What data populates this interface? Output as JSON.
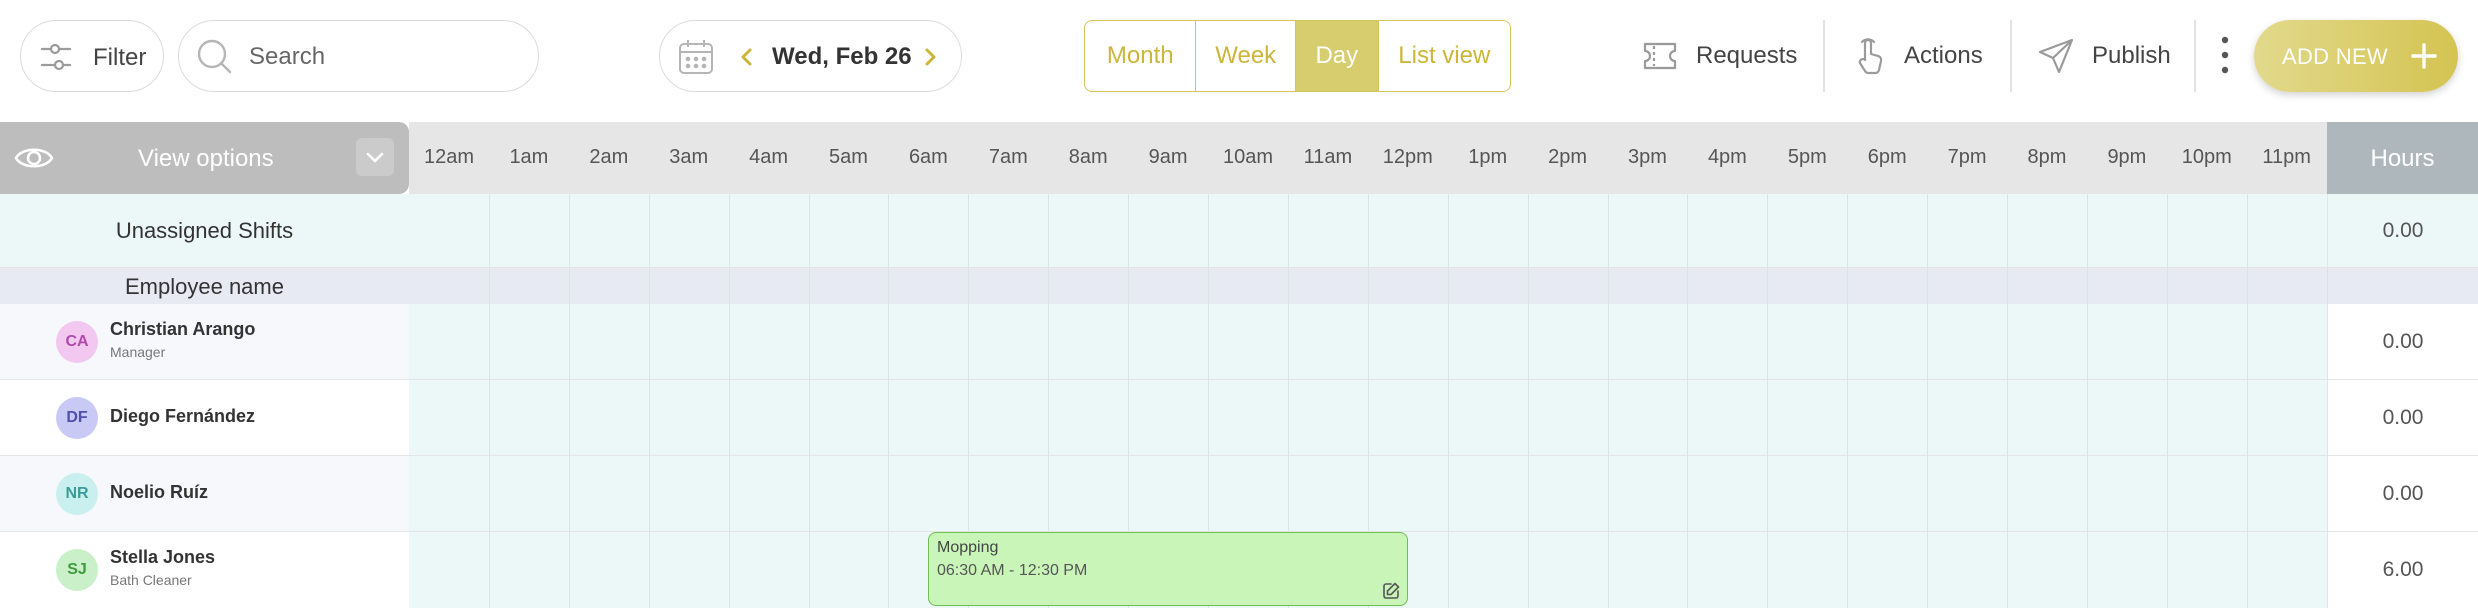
{
  "toolbar": {
    "filter_label": "Filter",
    "search_placeholder": "Search",
    "date_label": "Wed, Feb 26",
    "views": [
      "Month",
      "Week",
      "Day",
      "List view"
    ],
    "active_view": "Day",
    "requests_label": "Requests",
    "actions_label": "Actions",
    "publish_label": "Publish",
    "add_new_label": "ADD NEW"
  },
  "grid": {
    "view_options_label": "View options",
    "hours_header": "Hours",
    "time_ticks": [
      "12am",
      "1am",
      "2am",
      "3am",
      "4am",
      "5am",
      "6am",
      "7am",
      "8am",
      "9am",
      "10am",
      "11am",
      "12pm",
      "1pm",
      "2pm",
      "3pm",
      "4pm",
      "5pm",
      "6pm",
      "7pm",
      "8pm",
      "9pm",
      "10pm",
      "11pm"
    ],
    "unassigned_label": "Unassigned Shifts",
    "unassigned_hours": "0.00",
    "employee_name_header": "Employee name"
  },
  "employees": [
    {
      "initials": "CA",
      "name": "Christian Arango",
      "role": "Manager",
      "hours": "0.00",
      "avatar_bg": "#f2c8f0",
      "avatar_fg": "#b04aa8"
    },
    {
      "initials": "DF",
      "name": "Diego Fernández",
      "role": "",
      "hours": "0.00",
      "avatar_bg": "#c9c9f5",
      "avatar_fg": "#4f4fb0"
    },
    {
      "initials": "NR",
      "name": "Noelio Ruíz",
      "role": "",
      "hours": "0.00",
      "avatar_bg": "#c9f0ee",
      "avatar_fg": "#3a9c98"
    },
    {
      "initials": "SJ",
      "name": "Stella Jones",
      "role": "Bath Cleaner",
      "hours": "6.00",
      "avatar_bg": "#c9f0c9",
      "avatar_fg": "#3f9a3f"
    }
  ],
  "shift": {
    "title": "Mopping",
    "time": "06:30 AM - 12:30 PM"
  },
  "colors": {
    "accent": "#d4c452",
    "active_view_bg": "#d8cd6e",
    "shift_fill": "#c9f5b9",
    "shift_border": "#6fbf4f",
    "grid_bg": "#ecf7f7"
  },
  "icons": [
    "sliders-icon",
    "search-icon",
    "calendar-icon",
    "chevron-left-icon",
    "chevron-right-icon",
    "ticket-icon",
    "pointer-hand-icon",
    "send-icon",
    "kebab-icon",
    "plus-icon",
    "eye-icon",
    "chevron-down-icon",
    "edit-icon"
  ]
}
